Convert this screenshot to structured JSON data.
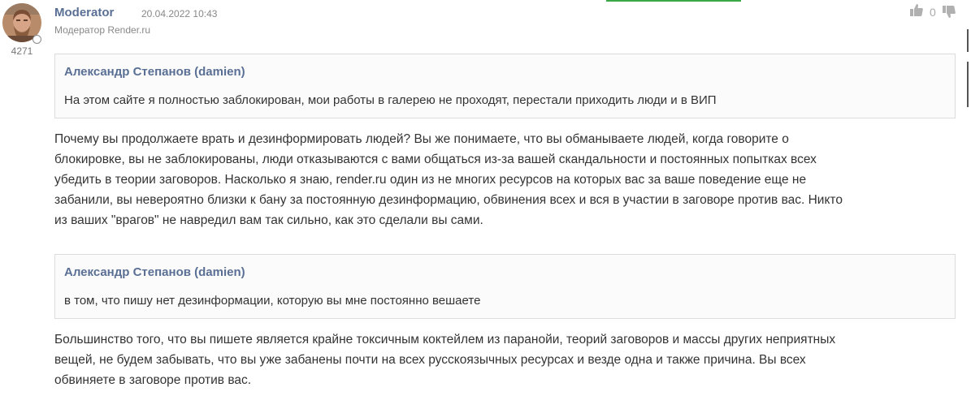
{
  "post": {
    "author": "Moderator",
    "timestamp": "20.04.2022 10:43",
    "role": "Модератор Render.ru",
    "reputation": "4271",
    "likes": "0"
  },
  "quotes": [
    {
      "author": "Александр Степанов (damien)",
      "text": "На этом сайте я полностью заблокирован, мои работы в галерею не проходят, перестали приходить люди и в ВИП"
    },
    {
      "author": "Александр Степанов (damien)",
      "text": "в том, что пишу нет дезинформации, которую вы мне постоянно вешаете"
    }
  ],
  "paragraphs": [
    {
      "lines": [
        "Почему вы продолжаете врать и дезинформировать людей? Вы же понимаете, что вы обманываете людей, когда говорите о",
        "блокировке, вы не заблокированы, люди отказываются с вами общаться из-за вашей скандальности и постоянных попытках всех",
        "убедить в теории заговоров. Насколько я знаю, render.ru один из не многих ресурсов на которых вас за ваше поведение еще не",
        "забанили, вы невероятно близки к бану за постоянную дезинформацию, обвинения всех и вся в участии в заговоре против вас. Никто",
        "из ваших \"врагов\" не навредил вам так сильно, как это сделали вы сами."
      ]
    },
    {
      "lines": [
        "Большинство того, что вы пишете является крайне токсичным коктейлем из паранойи, теорий заговоров и массы других неприятных",
        "вещей, не будем забывать, что вы уже забанены почти на всех русскоязычных ресурсах и везде одна и также причина. Вы всех",
        "обвиняете в заговоре против вас."
      ]
    }
  ],
  "colors": {
    "author": "#5a6f94",
    "text": "#333333",
    "meta": "#888888",
    "quote_border": "#dcdcdc",
    "accent_green": "#3aa846"
  },
  "icons": {
    "like": "thumbs-up-icon",
    "dislike": "thumbs-down-icon"
  }
}
